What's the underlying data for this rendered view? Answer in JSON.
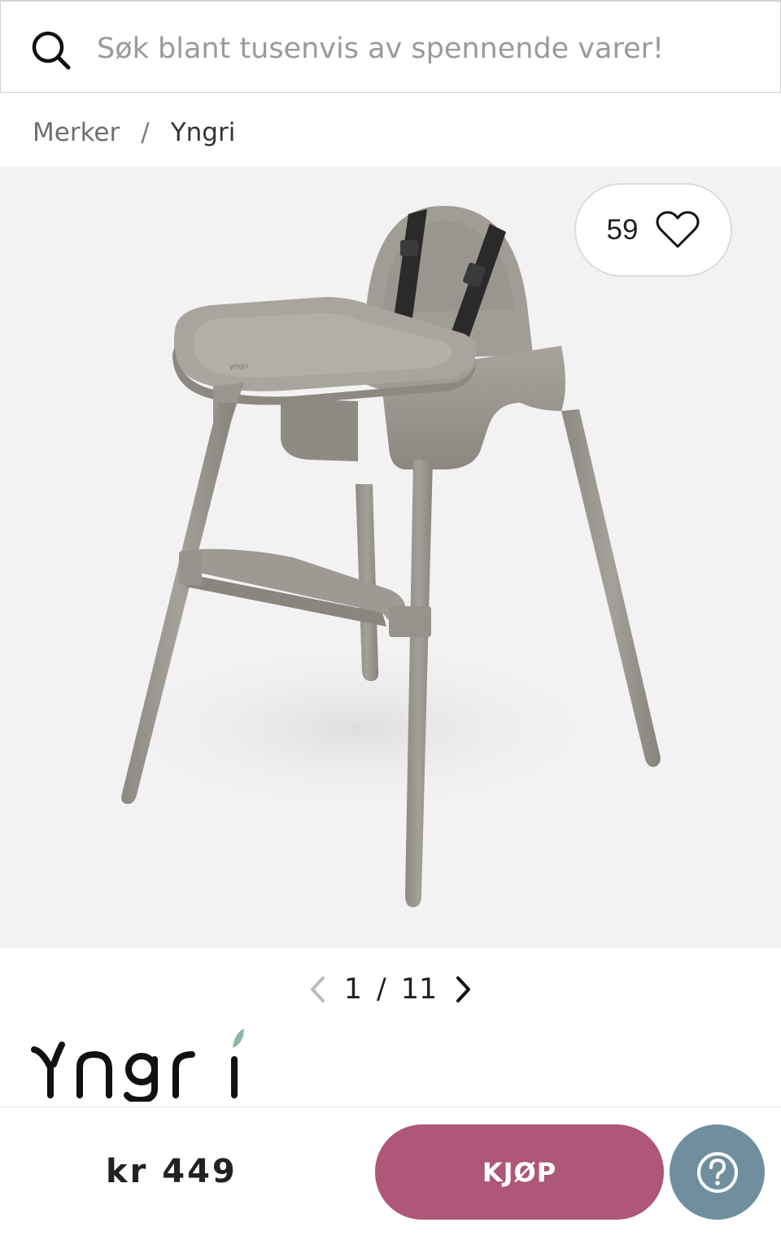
{
  "search": {
    "placeholder": "Søk blant tusenvis av spennende varer!",
    "icon": "search-icon"
  },
  "breadcrumb": {
    "items": [
      "Merker",
      "Yngri"
    ],
    "separator": "/"
  },
  "gallery": {
    "favorite_count": "59",
    "favorite_icon": "heart-outline-icon",
    "current_page": "1",
    "separator": "/",
    "total_pages": "11"
  },
  "brand": {
    "logo_text": "Yngri",
    "accent_color": "#8fb8a0"
  },
  "purchase": {
    "price": "kr 449",
    "buy_label": "KJØP",
    "buy_color": "#ae5778",
    "help_icon": "question-circle-icon",
    "help_color": "#6f8f9f"
  }
}
